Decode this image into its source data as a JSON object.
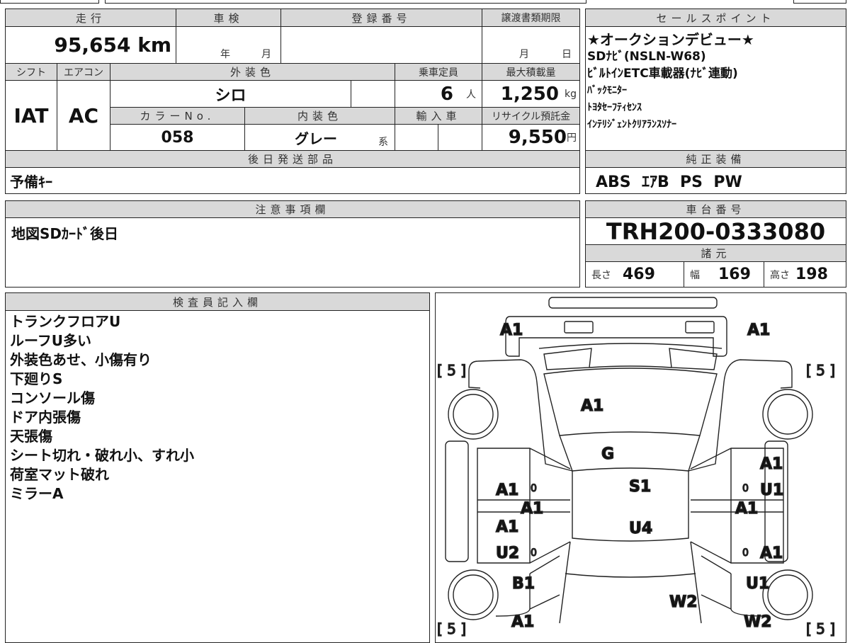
{
  "header": {
    "mileage_label": "走行",
    "inspection_label": "車検",
    "registration_label": "登録番号",
    "transfer_deadline_label": "譲渡書類期限"
  },
  "values": {
    "mileage": "95,654 km",
    "inspection_year": "年",
    "inspection_month": "月",
    "deadline_month": "月",
    "deadline_day": "日"
  },
  "row2": {
    "shift_label": "シフト",
    "ac_label": "エアコン",
    "exterior_color_label": "外装色",
    "capacity_label": "乗車定員",
    "max_load_label": "最大積載量"
  },
  "row2_values": {
    "shift": "IAT",
    "ac": "AC",
    "exterior_color": "シロ",
    "capacity": "6",
    "capacity_unit": "人",
    "max_load": "1,250",
    "max_load_unit": "kg"
  },
  "row3": {
    "color_no_label": "カラーNo.",
    "interior_color_label": "内装色",
    "import_label": "輸入車",
    "recycle_label": "リサイクル預託金"
  },
  "row3_values": {
    "color_no": "058",
    "interior_color": "グレー",
    "interior_suffix": "系",
    "recycle_fee": "9,550",
    "recycle_unit": "円"
  },
  "later_parts": {
    "label": "後日発送部品",
    "value": "予備ｷｰ"
  },
  "notes": {
    "label": "注意事項欄",
    "value": "地図SDｶｰﾄﾞ後日"
  },
  "inspector": {
    "label": "検査員記入欄",
    "items": [
      "トランクフロアU",
      "ルーフU多い",
      "外装色あせ、小傷有り",
      "下廻りS",
      "コンソール傷",
      "ドア内張傷",
      "天張傷",
      "シート切れ・破れ小、すれ小",
      "荷室マット破れ",
      "ミラーA"
    ]
  },
  "sales_points": {
    "label": "セールスポイント",
    "items": [
      "★オークションデビュー★",
      "SDﾅﾋﾞ(NSLN-W68)",
      "ﾋﾞﾙﾄｲﾝETC車載器(ﾅﾋﾞ連動)",
      "ﾊﾞｯｸﾓﾆﾀｰ",
      "ﾄﾖﾀｾｰﾌﾃｨｾﾝｽ",
      "ｲﾝﾃﾘｼﾞｪﾝﾄｸﾘｱﾗﾝｽｿﾅｰ"
    ]
  },
  "equipment": {
    "label": "純正装備",
    "value": "ABS  ｴｱB  PS  PW"
  },
  "chassis": {
    "label": "車台番号",
    "value": "TRH200-0333080"
  },
  "specs": {
    "label": "諸元",
    "length_label": "長さ",
    "length": "469",
    "width_label": "幅",
    "width": "169",
    "height_label": "高さ",
    "height": "198"
  },
  "diagram": {
    "tire_marks": [
      "[ 5 ]",
      "[ 5 ]",
      "[ 5 ]",
      "[ 5 ]"
    ],
    "marks": {
      "front_left": "A1",
      "front_right": "A1",
      "hood": "A1",
      "windshield": "G",
      "roof": "S1",
      "rear_roof": "U4",
      "lf_fender": "A1",
      "l_step": "A1",
      "lr_door": "A1",
      "lr_door2": "U2",
      "lr_quarter": "B1",
      "l_rear": "A1",
      "rf_door": "A1",
      "rf_door2": "U1",
      "r_step": "A1",
      "rr_door": "A1",
      "rr_quarter": "U1",
      "r_rear": "W2",
      "back_door": "W2"
    },
    "zero": "0"
  }
}
